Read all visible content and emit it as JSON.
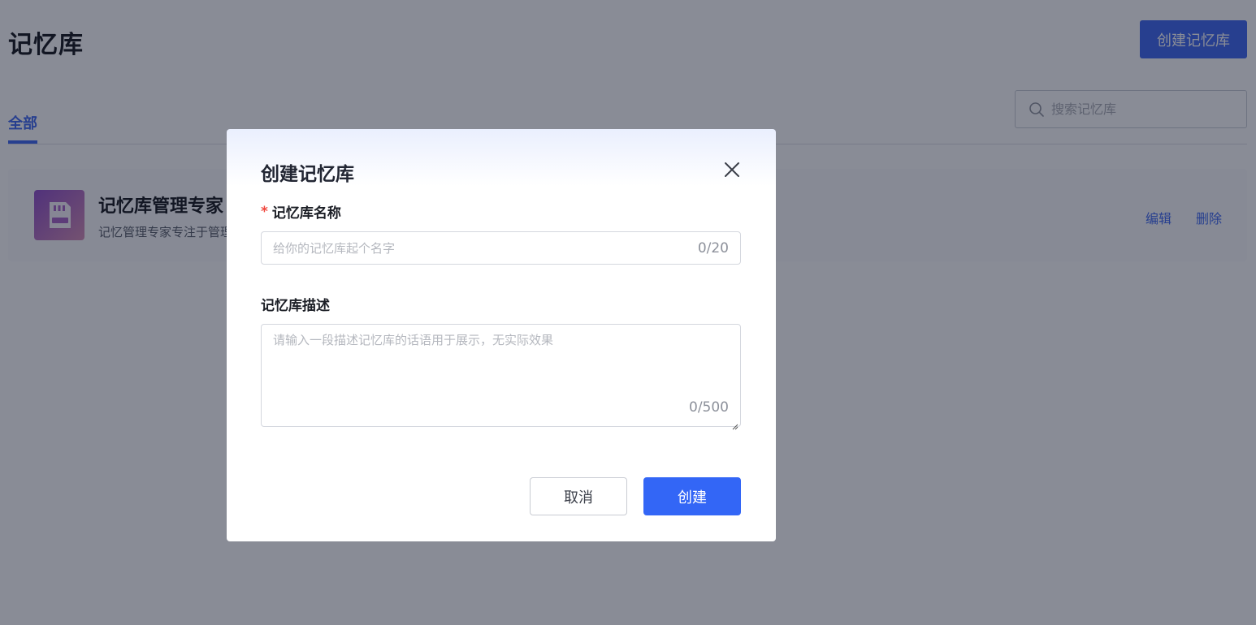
{
  "header": {
    "title": "记忆库",
    "create_button_label": "创建记忆库"
  },
  "tabs": [
    {
      "label": "全部",
      "active": true
    }
  ],
  "search": {
    "placeholder": "搜索记忆库",
    "icon": "search-icon"
  },
  "cards": [
    {
      "name": "记忆库管理专家",
      "description": "记忆管理专家专注于管理",
      "icon": "memory-card-icon",
      "actions": {
        "edit": "编辑",
        "delete": "删除"
      }
    }
  ],
  "modal": {
    "title": "创建记忆库",
    "close_icon": "close-icon",
    "name_field": {
      "required_mark": "*",
      "label": "记忆库名称",
      "placeholder": "给你的记忆库起个名字",
      "counter": "0/20"
    },
    "description_field": {
      "label": "记忆库描述",
      "placeholder": "请输入一段描述记忆库的话语用于展示，无实际效果",
      "counter": "0/500"
    },
    "cancel_label": "取消",
    "confirm_label": "创建"
  },
  "colors": {
    "primary": "#3366f6",
    "required": "#f0483e",
    "overlay": "rgba(20,26,45,0.5)"
  }
}
